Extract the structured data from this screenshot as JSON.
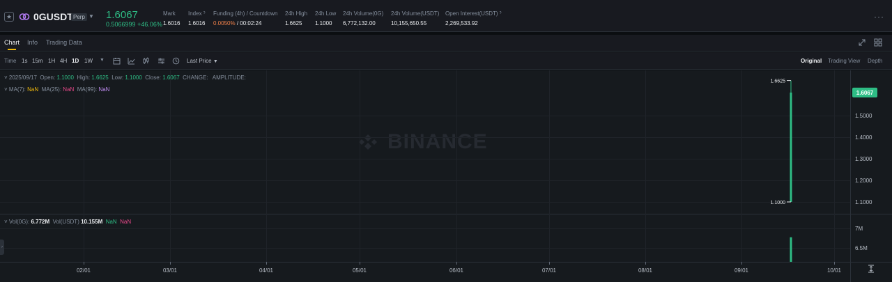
{
  "ticker": {
    "symbol": "0GUSDT",
    "badge": "Perp",
    "last_price": "1.6067",
    "change_abs": "0.5066999",
    "change_pct": "+46.06%",
    "stats": [
      {
        "label": "Mark",
        "value": "1.6016"
      },
      {
        "label": "Index ˀ",
        "value": "1.6016"
      },
      {
        "label": "Funding (4h) / Countdown",
        "value_highlight": "0.0050%",
        "value": " / 00:02:24"
      },
      {
        "label": "24h High",
        "value": "1.6625"
      },
      {
        "label": "24h Low",
        "value": "1.1000"
      },
      {
        "label": "24h Volume(0G)",
        "value": "6,772,132.00"
      },
      {
        "label": "24h Volume(USDT)",
        "value": "10,155,650.55"
      },
      {
        "label": "Open Interest(USDT) ˀ",
        "value": "2,269,533.92"
      }
    ],
    "more": "···"
  },
  "tabs": [
    {
      "label": "Chart",
      "active": true
    },
    {
      "label": "Info",
      "active": false
    },
    {
      "label": "Trading Data",
      "active": false
    }
  ],
  "toolbar": {
    "intervals": [
      "Time",
      "1s",
      "15m",
      "1H",
      "4H",
      "1D",
      "1W"
    ],
    "active_interval": "1D",
    "price_mode": "Last Price",
    "views": [
      "Original",
      "Trading View",
      "Depth"
    ],
    "active_view": "Original"
  },
  "legend": {
    "date": "2025/09/17",
    "open_label": "Open:",
    "open": "1.1000",
    "high_label": "High:",
    "high": "1.6625",
    "low_label": "Low:",
    "low": "1.1000",
    "close_label": "Close:",
    "close": "1.6067",
    "change_label": "CHANGE:",
    "amplitude_label": "AMPLITUDE:",
    "ma7_label": "MA(7):",
    "ma7": "NaN",
    "ma25_label": "MA(25):",
    "ma25": "NaN",
    "ma99_label": "MA(99):",
    "ma99": "NaN",
    "vol_label": "Vol(0G):",
    "vol": "6.772M",
    "vol_usdt_label": "Vol(USDT)",
    "vol_usdt": "10.155M",
    "vol_ma1": "NaN",
    "vol_ma2": "NaN"
  },
  "watermark": "BINANCE",
  "colors": {
    "up": "#2ebd85",
    "down": "#f6465d",
    "accent": "#f0b90b"
  },
  "chart_data": {
    "type": "candlestick",
    "title": "",
    "x_ticks": [
      "02/01",
      "03/01",
      "04/01",
      "05/01",
      "06/01",
      "07/01",
      "08/01",
      "09/01",
      "10/01"
    ],
    "y_ticks": [
      "1.5000",
      "1.4000",
      "1.3000",
      "1.2000",
      "1.1000"
    ],
    "ylim": [
      1.08,
      1.7
    ],
    "candles": [
      {
        "date": "2025/09/17",
        "open": 1.1,
        "high": 1.6625,
        "low": 1.1,
        "close": 1.6067
      }
    ],
    "price_tag": "1.6067",
    "high_marker": "1.6625",
    "low_marker": "1.1000",
    "volume": {
      "y_ticks": [
        "7M",
        "6.5M"
      ],
      "ylim": [
        6.2,
        7.2
      ],
      "bars": [
        {
          "date": "2025/09/17",
          "value": 6.772
        }
      ]
    }
  }
}
